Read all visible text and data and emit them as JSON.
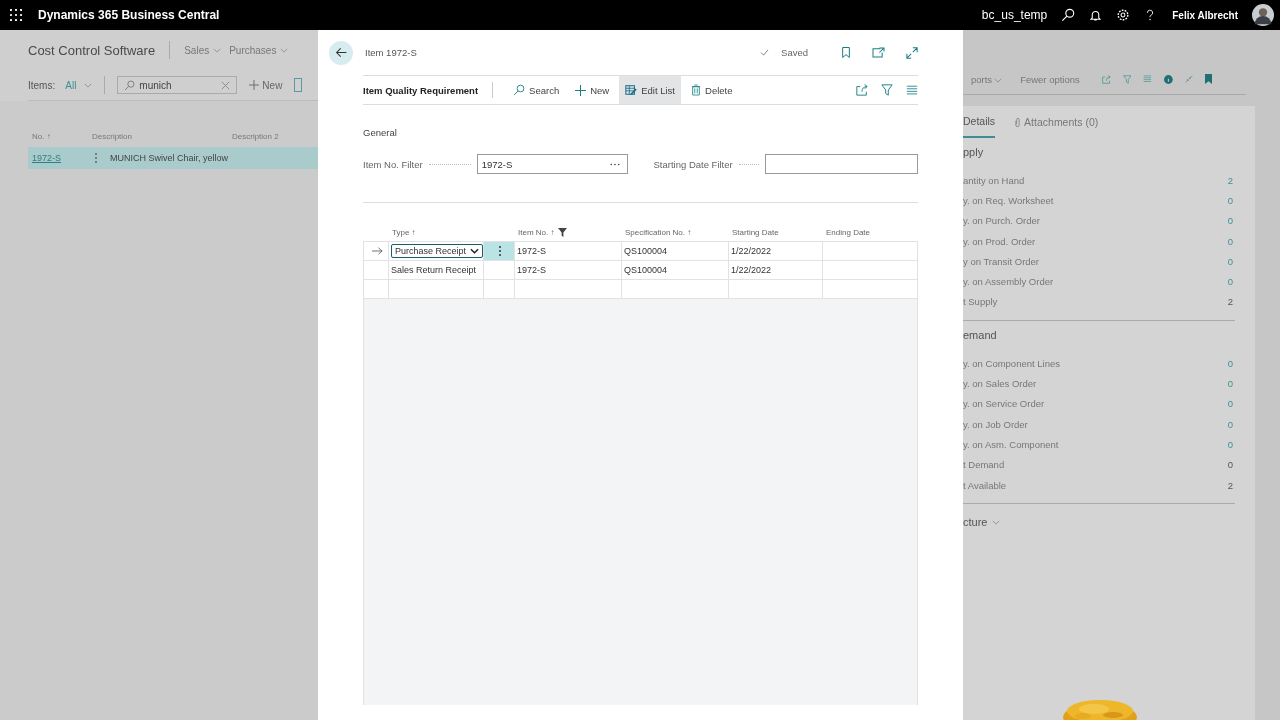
{
  "top_bar": {
    "app_name": "Dynamics 365 Business Central",
    "company": "bc_us_temp",
    "user": "Felix Albrecht"
  },
  "list_page": {
    "title": "Cost Control Software",
    "menus": [
      {
        "label": "Sales"
      },
      {
        "label": "Purchases"
      }
    ],
    "view_label": "Items:",
    "view": "All",
    "search": {
      "value": "munich"
    },
    "new_label": "New",
    "columns": [
      {
        "label": "No. ↑"
      },
      {
        "label": "Description"
      },
      {
        "label": "Description 2"
      }
    ],
    "rows": [
      {
        "no": "1972-S",
        "description": "MUNICH Swivel Chair, yellow",
        "selected": true
      }
    ]
  },
  "right_pane": {
    "actions": [
      {
        "label": "ports",
        "menu": true
      },
      {
        "label": "Fewer options",
        "menu": false
      }
    ],
    "tabs": [
      {
        "label": "Details",
        "selected": true
      },
      {
        "label": "Attachments (0)",
        "selected": false
      }
    ],
    "sections": [
      {
        "title": "pply",
        "rows": [
          {
            "label": "antity on Hand",
            "value": "2",
            "drilldown": true
          },
          {
            "label": "y. on Req. Worksheet",
            "value": "0",
            "drilldown": true
          },
          {
            "label": "y. on Purch. Order",
            "value": "0",
            "drilldown": true
          },
          {
            "label": "y. on Prod. Order",
            "value": "0",
            "drilldown": true
          },
          {
            "label": "y on Transit Order",
            "value": "0",
            "drilldown": true
          },
          {
            "label": "y. on Assembly Order",
            "value": "0",
            "drilldown": true
          },
          {
            "label": "t Supply",
            "value": "2",
            "drilldown": false
          }
        ]
      },
      {
        "title": "emand",
        "rows": [
          {
            "label": "y. on Component Lines",
            "value": "0",
            "drilldown": true
          },
          {
            "label": "y. on Sales Order",
            "value": "0",
            "drilldown": true
          },
          {
            "label": "y. on Service Order",
            "value": "0",
            "drilldown": true
          },
          {
            "label": "y. on Job Order",
            "value": "0",
            "drilldown": true
          },
          {
            "label": "y. on Asm. Component",
            "value": "0",
            "drilldown": true
          },
          {
            "label": "t Demand",
            "value": "0",
            "drilldown": false
          },
          {
            "label": "t Available",
            "value": "2",
            "drilldown": false
          }
        ]
      }
    ],
    "picture_section": "cture"
  },
  "dialog": {
    "title": "Item 1972-S",
    "status": "Saved",
    "page_name": "Item Quality Requirement",
    "actions": [
      {
        "label": "Search",
        "selected": false
      },
      {
        "label": "New",
        "selected": false
      },
      {
        "label": "Edit List",
        "selected": true
      },
      {
        "label": "Delete",
        "selected": false
      }
    ],
    "section": "General",
    "filters": [
      {
        "label": "Item No. Filter",
        "value": "1972-S",
        "lookup": true
      },
      {
        "label": "Starting Date Filter",
        "lookup": false
      }
    ],
    "columns": [
      {
        "label": "Type ↑",
        "filtered": false
      },
      {
        "label": "Item No. ↑",
        "filtered": true
      },
      {
        "label": "Specification No. ↑",
        "filtered": false
      },
      {
        "label": "Starting Date",
        "filtered": false
      },
      {
        "label": "Ending Date",
        "filtered": false
      }
    ],
    "rows": [
      {
        "type": "Purchase Receipt",
        "item_no": "1972-S",
        "spec_no": "QS100004",
        "starting_date": "1/22/2022",
        "selected": true
      },
      {
        "type": "Sales Return Receipt",
        "item_no": "1972-S",
        "spec_no": "QS100004",
        "starting_date": "1/22/2022",
        "selected": false
      }
    ]
  }
}
